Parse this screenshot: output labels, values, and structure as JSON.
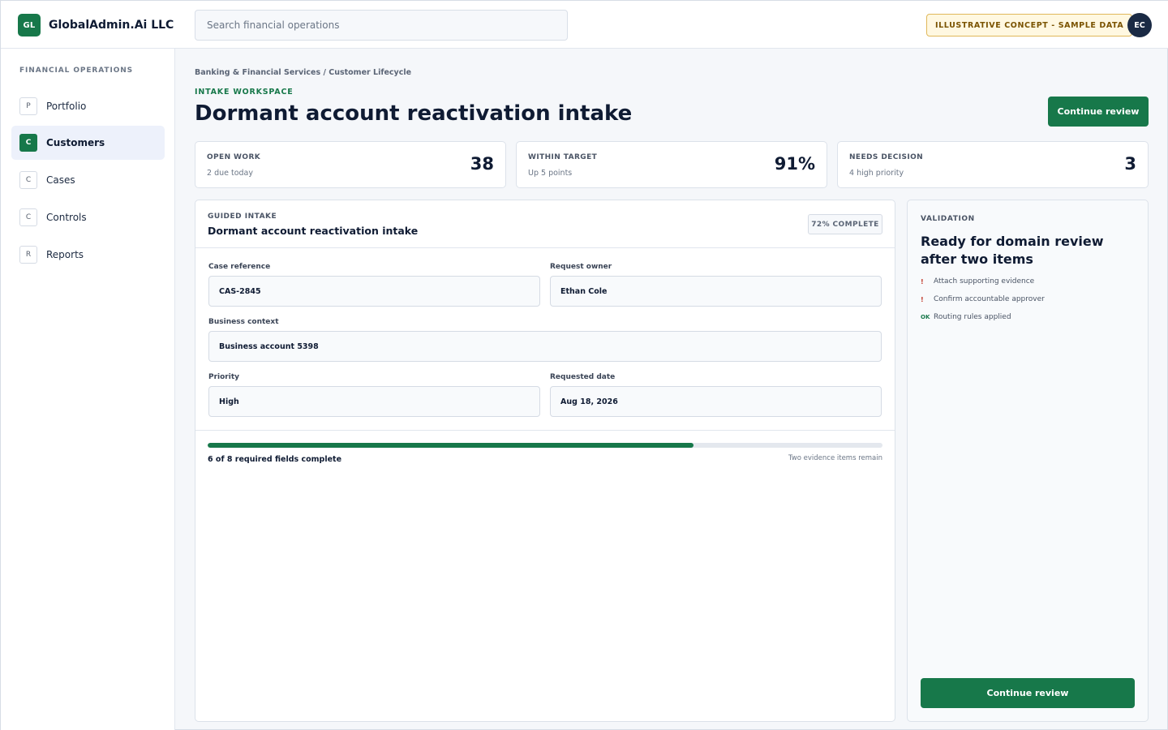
{
  "app": {
    "logo_text": "GL",
    "name": "GlobalAdmin.Ai LLC",
    "search_placeholder": "Search financial operations",
    "concept_badge": "ILLUSTRATIVE CONCEPT - SAMPLE DATA",
    "avatar_initials": "EC"
  },
  "sidebar": {
    "heading": "FINANCIAL OPERATIONS",
    "items": [
      {
        "letter": "P",
        "label": "Portfolio",
        "active": false
      },
      {
        "letter": "C",
        "label": "Customers",
        "active": true
      },
      {
        "letter": "C",
        "label": "Cases",
        "active": false
      },
      {
        "letter": "C",
        "label": "Controls",
        "active": false
      },
      {
        "letter": "R",
        "label": "Reports",
        "active": false
      }
    ]
  },
  "header": {
    "breadcrumb": "Banking & Financial Services / Customer Lifecycle",
    "eyebrow": "INTAKE WORKSPACE",
    "title": "Dormant account reactivation intake",
    "primary_action": "Continue review"
  },
  "stats": [
    {
      "label": "OPEN WORK",
      "sub": "2 due today",
      "value": "38"
    },
    {
      "label": "WITHIN TARGET",
      "sub": "Up 5 points",
      "value": "91%"
    },
    {
      "label": "NEEDS DECISION",
      "sub": "4 high priority",
      "value": "3"
    }
  ],
  "intake": {
    "eyebrow": "GUIDED INTAKE",
    "title": "Dormant account reactivation intake",
    "complete_badge": "72% COMPLETE",
    "fields": {
      "case_reference": {
        "label": "Case reference",
        "value": "CAS-2845"
      },
      "request_owner": {
        "label": "Request owner",
        "value": "Ethan Cole"
      },
      "business_context": {
        "label": "Business context",
        "value": "Business account 5398"
      },
      "priority": {
        "label": "Priority",
        "value": "High"
      },
      "requested_date": {
        "label": "Requested date",
        "value": "Aug 18, 2026"
      }
    },
    "progress": {
      "fraction": 0.72,
      "summary": "6 of 8 required fields complete",
      "note": "Two evidence items remain"
    }
  },
  "validation": {
    "eyebrow": "VALIDATION",
    "title": "Ready for domain review after two items",
    "items": [
      {
        "mark": "!",
        "status": "warn",
        "text": "Attach supporting evidence"
      },
      {
        "mark": "!",
        "status": "warn",
        "text": "Confirm accountable approver"
      },
      {
        "mark": "OK",
        "status": "ok",
        "text": "Routing rules applied"
      }
    ],
    "action": "Continue review"
  },
  "colors": {
    "accent": "#17784a",
    "navy": "#0f1b33",
    "badge_bg": "#fff8e1",
    "badge_border": "#e0b85a",
    "warn": "#c0392b"
  }
}
